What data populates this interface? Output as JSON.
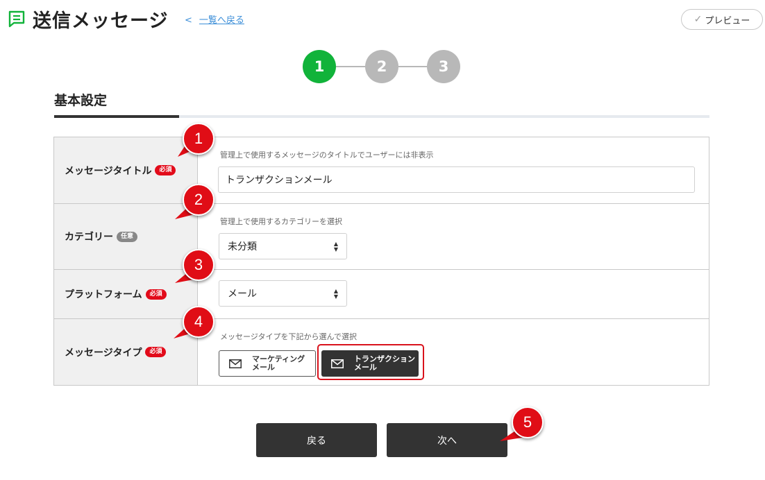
{
  "header": {
    "title": "送信メッセージ",
    "back_chevron": "<",
    "back_link": "一覧へ戻る",
    "preview_label": "プレビュー"
  },
  "stepper": {
    "steps": [
      {
        "label": "1",
        "active": true
      },
      {
        "label": "2",
        "active": false
      },
      {
        "label": "3",
        "active": false
      }
    ]
  },
  "section": {
    "title": "基本設定"
  },
  "form": {
    "rows": [
      {
        "label": "メッセージタイトル",
        "badge": "必須",
        "hint": "管理上で使用するメッセージのタイトルでユーザーには非表示",
        "value": "トランザクションメール"
      },
      {
        "label": "カテゴリー",
        "badge": "任意",
        "hint": "管理上で使用するカテゴリーを選択",
        "value": "未分類"
      },
      {
        "label": "プラットフォーム",
        "badge": "必須",
        "value": "メール"
      },
      {
        "label": "メッセージタイプ",
        "badge": "必須",
        "hint": "メッセージタイプを下記から選んで選択",
        "options": [
          {
            "line1": "マーケティング",
            "line2": "メール",
            "selected": false
          },
          {
            "line1": "トランザクション",
            "line2": "メール",
            "selected": true
          }
        ]
      }
    ]
  },
  "buttons": {
    "back": "戻る",
    "next": "次へ"
  },
  "callouts": [
    "1",
    "2",
    "3",
    "4",
    "5"
  ],
  "colors": {
    "accent_green": "#11b33a",
    "step_inactive": "#b8b8b8",
    "required_badge": "#e20b1a",
    "callout_red": "#e00d16",
    "button_dark": "#333333",
    "link_blue": "#3b8ed8"
  },
  "icons": {
    "header": "message-list-icon",
    "preview": "check-icon",
    "mail": "envelope-icon"
  }
}
